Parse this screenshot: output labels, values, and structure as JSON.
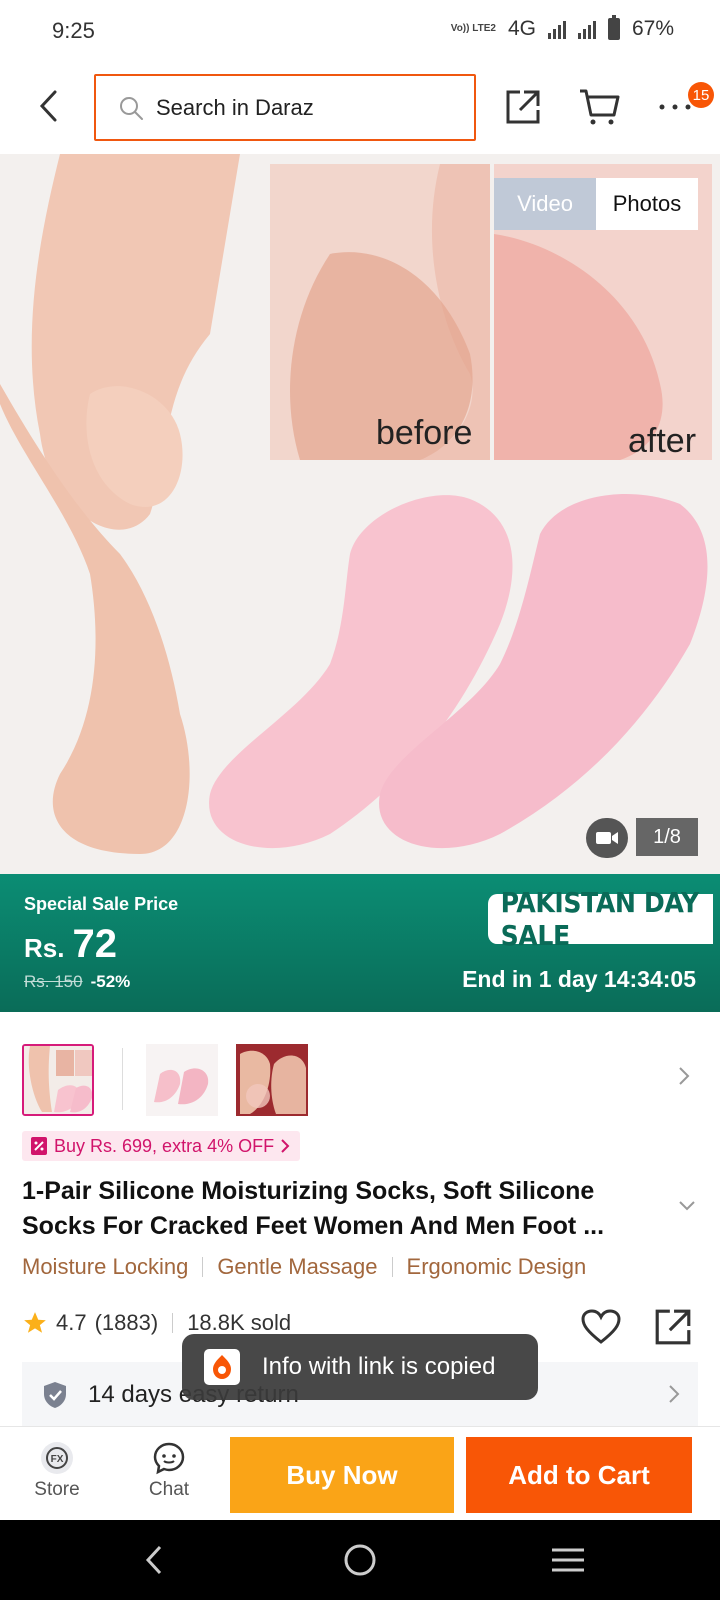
{
  "status": {
    "time": "9:25",
    "network": "4G",
    "volte": "Vo)) LTE2",
    "battery": "67%"
  },
  "search": {
    "placeholder": "Search in Daraz"
  },
  "header": {
    "more_badge": "15"
  },
  "gallery": {
    "tab_video": "Video",
    "tab_photos": "Photos",
    "counter": "1/8",
    "image_text_before": "before",
    "image_text_after": "after"
  },
  "sale": {
    "label": "Special Sale Price",
    "currency": "Rs.",
    "price": "72",
    "old_price": "Rs. 150",
    "discount": "-52%",
    "event_tag": "PAKISTAN DAY SALE",
    "countdown": "End in 1 day 14:34:05"
  },
  "promo": {
    "text": "Buy Rs. 699, extra 4% OFF"
  },
  "product": {
    "title_line1": "1-Pair Silicone Moisturizing Socks, Soft Silicone",
    "title_line2": "Socks For Cracked Feet Women And Men Foot ...",
    "features": [
      "Moisture Locking",
      "Gentle Massage",
      "Ergonomic Design"
    ],
    "rating": "4.7",
    "reviews": "(1883)",
    "sold": "18.8K sold"
  },
  "service": {
    "return_text": "14 days easy return"
  },
  "toast": {
    "text": "Info with link is copied"
  },
  "actions": {
    "store": "Store",
    "chat": "Chat",
    "buy_now": "Buy Now",
    "add_to_cart": "Add to Cart"
  },
  "colors": {
    "brand_orange": "#f85606",
    "buy_yellow": "#faa417",
    "sale_green": "#0b8d74",
    "promo_pink": "#d1146b",
    "feature_brown": "#a2673d"
  }
}
